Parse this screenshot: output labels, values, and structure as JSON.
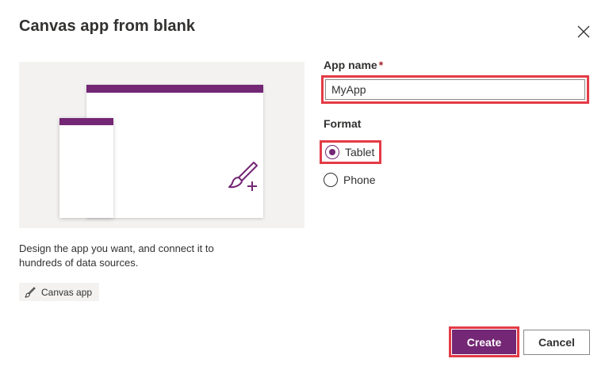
{
  "dialog": {
    "title": "Canvas app from blank",
    "close_icon": "close-icon"
  },
  "preview": {
    "description": "Design the app you want, and connect it to hundreds of data sources.",
    "tag_icon": "brush-icon",
    "tag_label": "Canvas app",
    "accent_color": "#742774"
  },
  "form": {
    "app_name_label": "App name",
    "required_marker": "*",
    "app_name_value": "MyApp",
    "format_label": "Format",
    "options": [
      {
        "label": "Tablet",
        "selected": true
      },
      {
        "label": "Phone",
        "selected": false
      }
    ]
  },
  "footer": {
    "create_label": "Create",
    "cancel_label": "Cancel"
  },
  "colors": {
    "brand": "#742774",
    "highlight": "#e33b46",
    "required": "#a4262c"
  }
}
